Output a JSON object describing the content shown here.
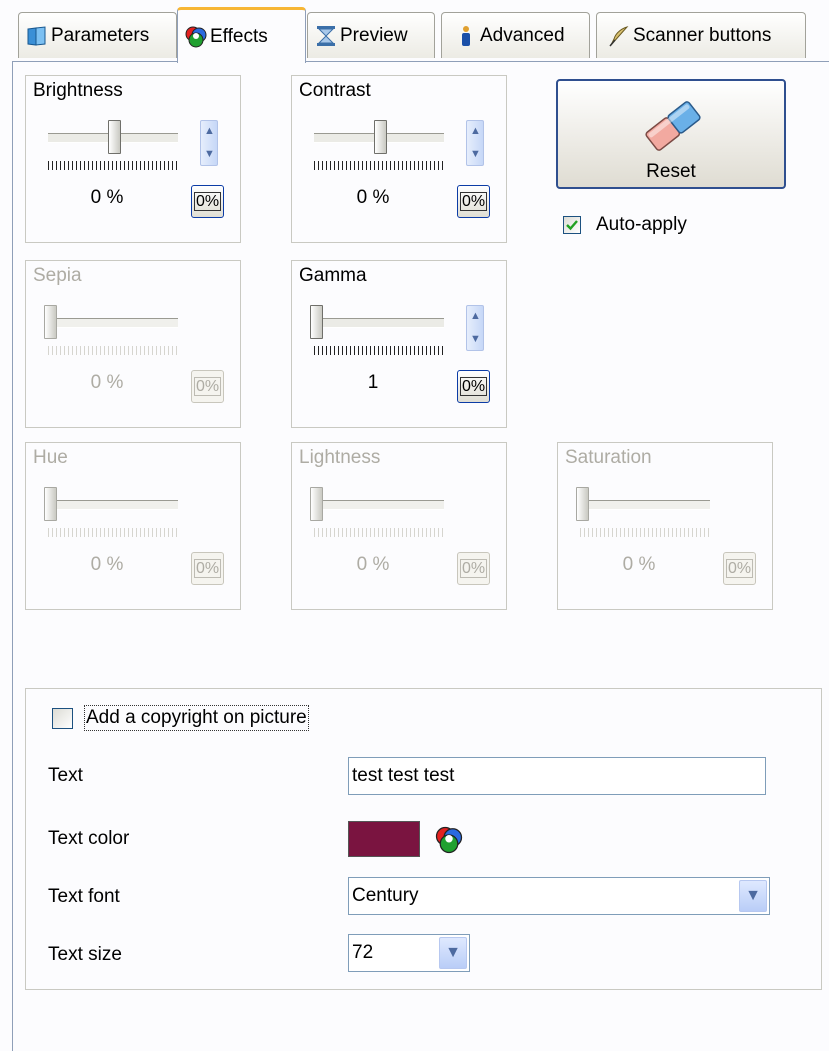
{
  "tabs": [
    {
      "label": "Parameters",
      "icon": "book-icon"
    },
    {
      "label": "Effects",
      "icon": "color-wheel-icon"
    },
    {
      "label": "Preview",
      "icon": "hourglass-icon"
    },
    {
      "label": "Advanced",
      "icon": "figure-icon"
    },
    {
      "label": "Scanner buttons",
      "icon": "quill-icon"
    }
  ],
  "effects": {
    "brightness": {
      "label": "Brightness",
      "value": "0 %",
      "button": "0%",
      "enabled": true,
      "slider_level": 0.5
    },
    "contrast": {
      "label": "Contrast",
      "value": "0 %",
      "button": "0%",
      "enabled": true,
      "slider_level": 0.5
    },
    "sepia": {
      "label": "Sepia",
      "value": "0 %",
      "button": "0%",
      "enabled": false,
      "slider_level": 0
    },
    "gamma": {
      "label": "Gamma",
      "value": "1",
      "button": "0%",
      "enabled": true,
      "slider_level": 0
    },
    "hue": {
      "label": "Hue",
      "value": "0 %",
      "button": "0%",
      "enabled": false,
      "slider_level": 0
    },
    "lightness": {
      "label": "Lightness",
      "value": "0 %",
      "button": "0%",
      "enabled": false,
      "slider_level": 0
    },
    "saturation": {
      "label": "Saturation",
      "value": "0 %",
      "button": "0%",
      "enabled": false,
      "slider_level": 0
    }
  },
  "reset": {
    "label": "Reset",
    "icon": "eraser-icon"
  },
  "auto_apply": {
    "label": "Auto-apply",
    "checked": true
  },
  "copyright": {
    "checkbox_label": "Add a copyright on picture",
    "checked": false,
    "text_label": "Text",
    "text_value": "test test test",
    "color_label": "Text color",
    "color_value": "#7a1440",
    "font_label": "Text font",
    "font_value": "Century",
    "size_label": "Text size",
    "size_value": "72"
  }
}
